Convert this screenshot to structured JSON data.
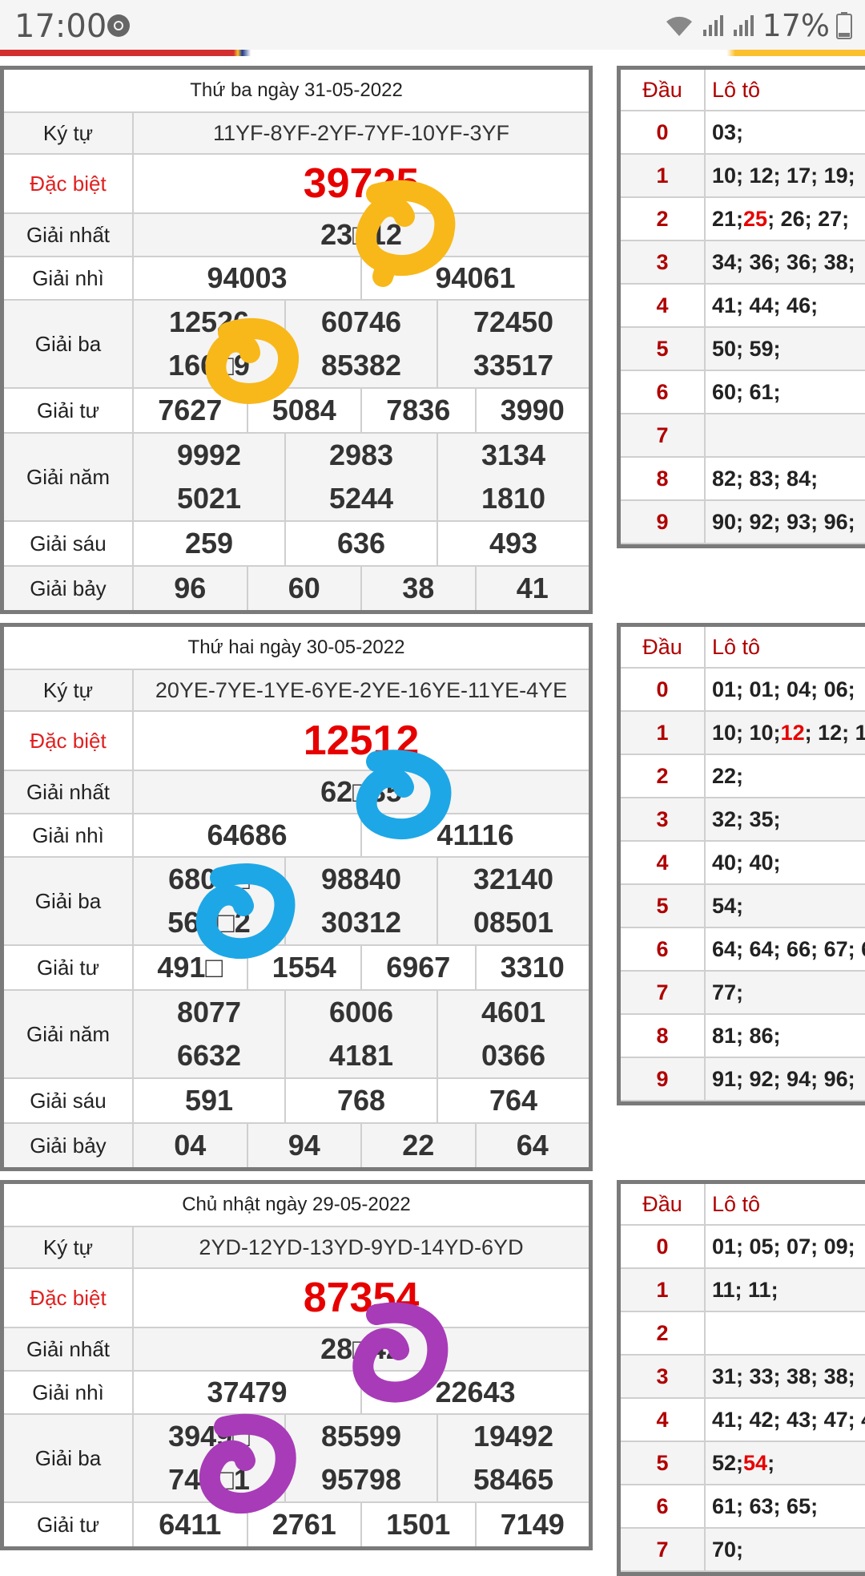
{
  "status_bar": {
    "time": "17:00",
    "battery": "17%",
    "icons": [
      "chrome-icon",
      "wifi-icon",
      "signal-icon",
      "battery-icon"
    ]
  },
  "days": [
    {
      "title": "Thứ ba ngày 31-05-2022",
      "ky_tu": "11YF-8YF-2YF-7YF-10YF-3YF",
      "dac_biet": "39725",
      "giai_nhat": "23□12",
      "giai_nhi": [
        "94003",
        "94061"
      ],
      "giai_ba": [
        "12526",
        "60746",
        "72450",
        "166□9",
        "85382",
        "33517"
      ],
      "giai_tu": [
        "7627",
        "5084",
        "7836",
        "3990"
      ],
      "giai_nam": [
        "9992",
        "2983",
        "3134",
        "5021",
        "5244",
        "1810"
      ],
      "giai_sau": [
        "259",
        "636",
        "493"
      ],
      "giai_bay": [
        "96",
        "60",
        "38",
        "41"
      ],
      "loto": [
        {
          "dau": "0",
          "parts": [
            {
              "t": "03;"
            }
          ]
        },
        {
          "dau": "1",
          "parts": [
            {
              "t": "10; 12; 17; 19;"
            }
          ]
        },
        {
          "dau": "2",
          "parts": [
            {
              "t": "21; "
            },
            {
              "t": "25",
              "hl": true
            },
            {
              "t": "; 26; 27;"
            }
          ]
        },
        {
          "dau": "3",
          "parts": [
            {
              "t": "34; 36; 36; 38;"
            }
          ]
        },
        {
          "dau": "4",
          "parts": [
            {
              "t": "41; 44; 46;"
            }
          ]
        },
        {
          "dau": "5",
          "parts": [
            {
              "t": "50; 59;"
            }
          ]
        },
        {
          "dau": "6",
          "parts": [
            {
              "t": "60; 61;"
            }
          ]
        },
        {
          "dau": "7",
          "parts": [
            {
              "t": ""
            }
          ]
        },
        {
          "dau": "8",
          "parts": [
            {
              "t": "82; 83; 84;"
            }
          ]
        },
        {
          "dau": "9",
          "parts": [
            {
              "t": "90; 92; 93; 96;"
            }
          ]
        }
      ]
    },
    {
      "title": "Thứ hai ngày 30-05-2022",
      "ky_tu": "20YE-7YE-1YE-6YE-2YE-16YE-11YE-4YE",
      "dac_biet": "12512",
      "giai_nhat": "62□35",
      "giai_nhi": [
        "64686",
        "41116"
      ],
      "giai_ba": [
        "6809□",
        "98840",
        "32140",
        "56□□2",
        "30312",
        "08501"
      ],
      "giai_tu": [
        "491□",
        "1554",
        "6967",
        "3310"
      ],
      "giai_nam": [
        "8077",
        "6006",
        "4601",
        "6632",
        "4181",
        "0366"
      ],
      "giai_sau": [
        "591",
        "768",
        "764"
      ],
      "giai_bay": [
        "04",
        "94",
        "22",
        "64"
      ],
      "loto": [
        {
          "dau": "0",
          "parts": [
            {
              "t": "01; 01; 04; 06;"
            }
          ]
        },
        {
          "dau": "1",
          "parts": [
            {
              "t": "10; 10; "
            },
            {
              "t": "12",
              "hl": true
            },
            {
              "t": "; 12; 1"
            }
          ]
        },
        {
          "dau": "2",
          "parts": [
            {
              "t": "22;"
            }
          ]
        },
        {
          "dau": "3",
          "parts": [
            {
              "t": "32; 35;"
            }
          ]
        },
        {
          "dau": "4",
          "parts": [
            {
              "t": "40; 40;"
            }
          ]
        },
        {
          "dau": "5",
          "parts": [
            {
              "t": "54;"
            }
          ]
        },
        {
          "dau": "6",
          "parts": [
            {
              "t": "64; 64; 66; 67; 6"
            }
          ]
        },
        {
          "dau": "7",
          "parts": [
            {
              "t": "77;"
            }
          ]
        },
        {
          "dau": "8",
          "parts": [
            {
              "t": "81; 86;"
            }
          ]
        },
        {
          "dau": "9",
          "parts": [
            {
              "t": "91; 92; 94; 96;"
            }
          ]
        }
      ]
    },
    {
      "title": "Chủ nhật ngày 29-05-2022",
      "ky_tu": "2YD-12YD-13YD-9YD-14YD-6YD",
      "dac_biet": "87354",
      "giai_nhat": "28□42",
      "giai_nhi": [
        "37479",
        "22643"
      ],
      "giai_ba": [
        "3949□",
        "85599",
        "19492",
        "744□1",
        "95798",
        "58465"
      ],
      "giai_tu": [
        "6411",
        "2761",
        "1501",
        "7149"
      ],
      "loto": [
        {
          "dau": "0",
          "parts": [
            {
              "t": "01; 05; 07; 09;"
            }
          ]
        },
        {
          "dau": "1",
          "parts": [
            {
              "t": "11; 11;"
            }
          ]
        },
        {
          "dau": "2",
          "parts": [
            {
              "t": ""
            }
          ]
        },
        {
          "dau": "3",
          "parts": [
            {
              "t": "31; 33; 38; 38;"
            }
          ]
        },
        {
          "dau": "4",
          "parts": [
            {
              "t": "41; 42; 43; 47; 4"
            }
          ]
        },
        {
          "dau": "5",
          "parts": [
            {
              "t": "52; "
            },
            {
              "t": "54",
              "hl": true
            },
            {
              "t": ";"
            }
          ]
        },
        {
          "dau": "6",
          "parts": [
            {
              "t": "61; 63; 65;"
            }
          ]
        },
        {
          "dau": "7",
          "parts": [
            {
              "t": "70;"
            }
          ]
        }
      ]
    }
  ],
  "labels": {
    "ky_tu": "Ký tự",
    "dac_biet": "Đặc biệt",
    "giai_nhat": "Giải nhất",
    "giai_nhi": "Giải nhì",
    "giai_ba": "Giải ba",
    "giai_tu": "Giải tư",
    "giai_nam": "Giải năm",
    "giai_sau": "Giải sáu",
    "giai_bay": "Giải bảy",
    "dau": "Đầu",
    "loto": "Lô tô"
  },
  "colors": {
    "special": "#e60000",
    "dau": "#b00000",
    "scribble_1": "#f8b81a",
    "scribble_2": "#1ea7e6",
    "scribble_3": "#a83bb8"
  }
}
